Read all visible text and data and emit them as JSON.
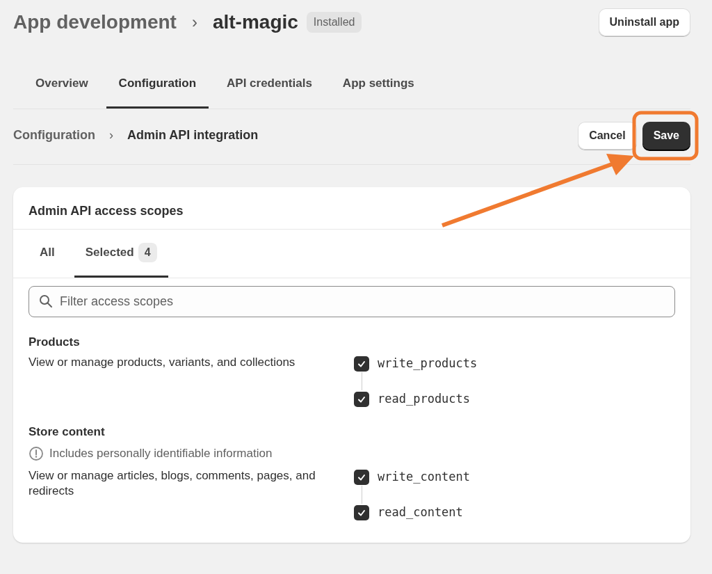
{
  "breadcrumb": {
    "parent": "App development",
    "separator": "›",
    "current": "alt-magic",
    "badge": "Installed"
  },
  "header_button": "Uninstall app",
  "tabs": [
    {
      "label": "Overview",
      "selected": false
    },
    {
      "label": "Configuration",
      "selected": true
    },
    {
      "label": "API credentials",
      "selected": false
    },
    {
      "label": "App settings",
      "selected": false
    }
  ],
  "sub_breadcrumb": {
    "parent": "Configuration",
    "separator": "›",
    "current": "Admin API integration"
  },
  "actions": [
    {
      "label": "Cancel",
      "kind": "secondary"
    },
    {
      "label": "Save",
      "kind": "primary"
    }
  ],
  "card": {
    "title": "Admin API access scopes",
    "tabs": [
      {
        "label": "All",
        "selected": false
      },
      {
        "label": "Selected",
        "count": "4",
        "selected": true
      }
    ],
    "search": {
      "placeholder": "Filter access scopes"
    },
    "sections": [
      {
        "title": "Products",
        "description": "View or manage products, variants, and collections",
        "scopes": [
          {
            "name": "write_products",
            "checked": true
          },
          {
            "name": "read_products",
            "checked": true
          }
        ]
      },
      {
        "title": "Store content",
        "warning": "Includes personally identifiable information",
        "description": "View or manage articles, blogs, comments, pages, and redirects",
        "scopes": [
          {
            "name": "write_content",
            "checked": true
          },
          {
            "name": "read_content",
            "checked": true
          }
        ]
      }
    ]
  }
}
